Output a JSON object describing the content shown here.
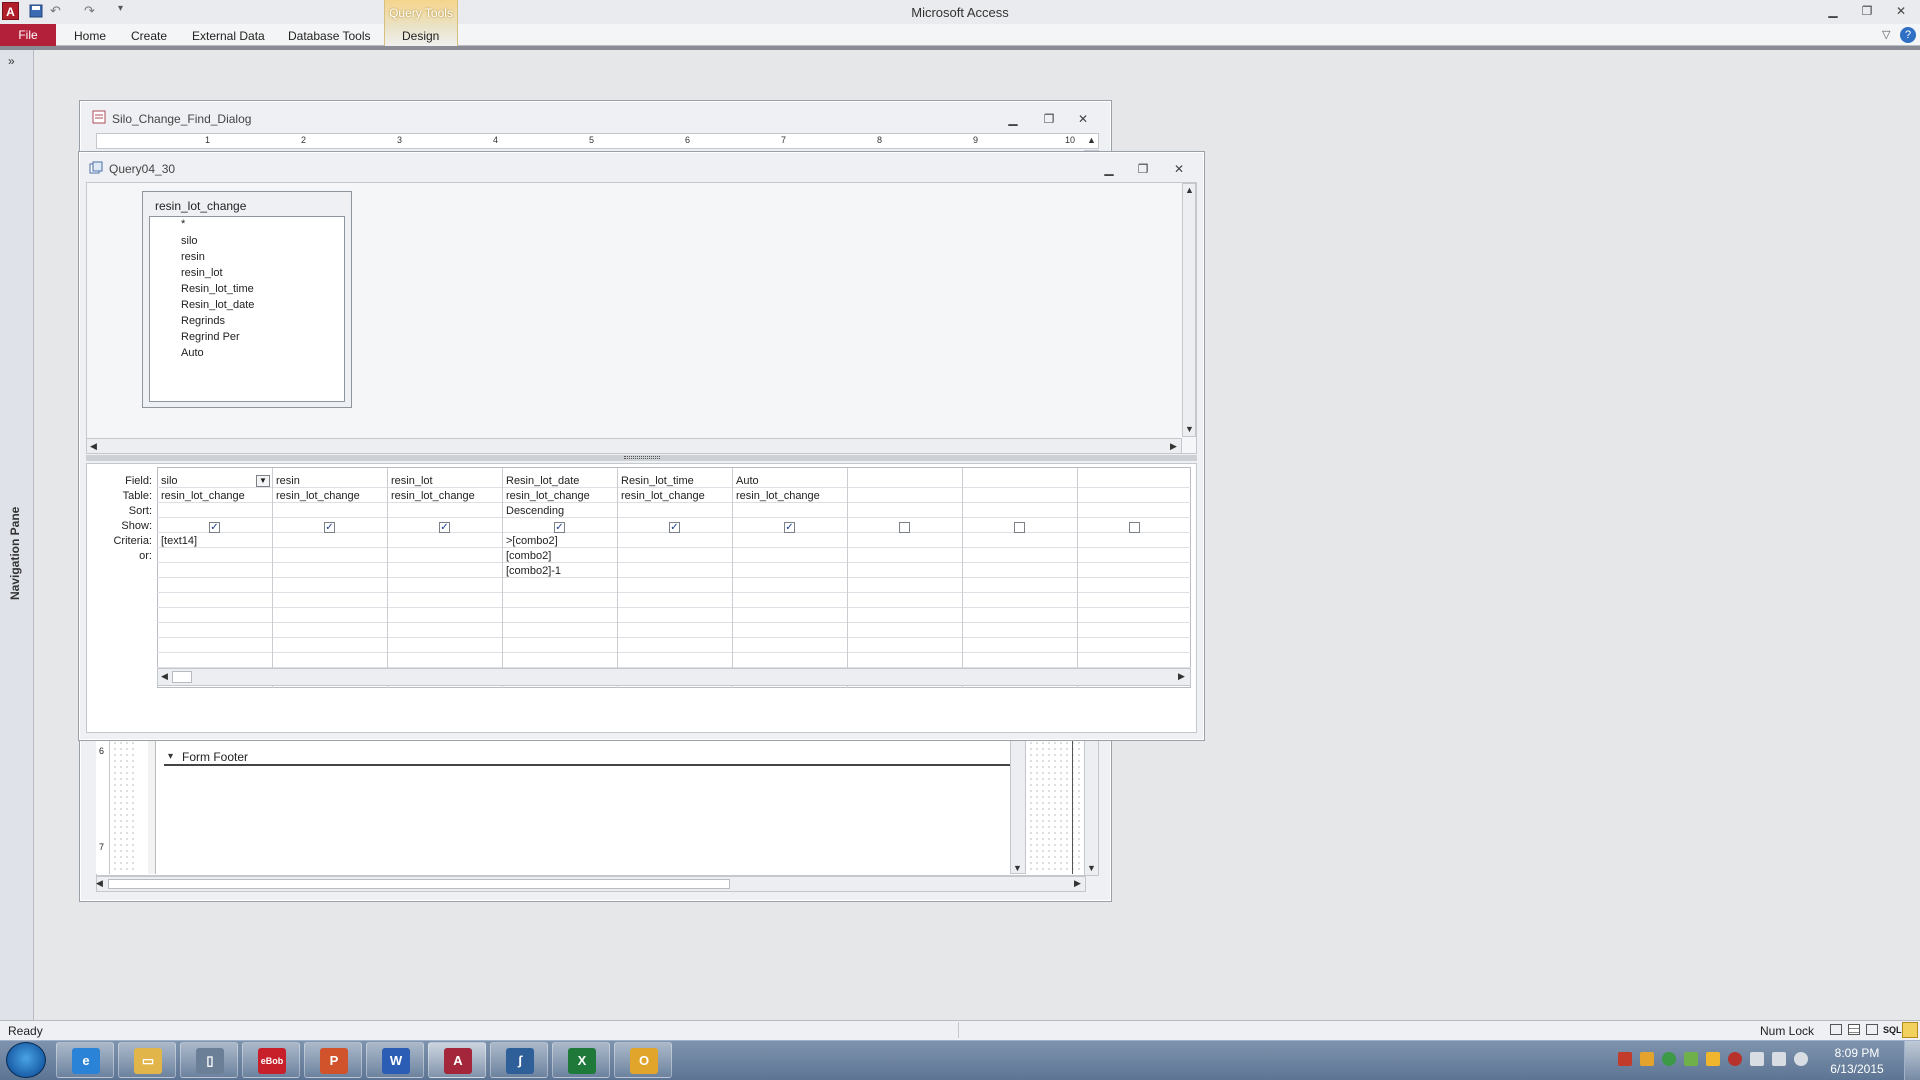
{
  "app": {
    "title": "Microsoft Access",
    "contextual_tab_group": "Query Tools"
  },
  "ribbon": {
    "tabs": [
      "File",
      "Home",
      "Create",
      "External Data",
      "Database Tools",
      "Design"
    ]
  },
  "nav_pane": {
    "label": "Navigation Pane",
    "toggle": "»"
  },
  "form_window": {
    "title": "Silo_Change_Find_Dialog",
    "ruler_numbers": [
      "1",
      "2",
      "3",
      "4",
      "5",
      "6",
      "7",
      "8",
      "9",
      "10"
    ],
    "footer_section": "Form Footer",
    "side_ruler_numbers": [
      "6",
      "7"
    ]
  },
  "query_window": {
    "title": "Query04_30",
    "table": {
      "name": "resin_lot_change",
      "fields": [
        "*",
        "silo",
        "resin",
        "resin_lot",
        "Resin_lot_time",
        "Resin_lot_date",
        "Regrinds",
        "Regrind Per",
        "Auto"
      ]
    },
    "grid": {
      "row_labels": [
        "Field:",
        "Table:",
        "Sort:",
        "Show:",
        "Criteria:",
        "or:"
      ],
      "columns": [
        {
          "field": "silo",
          "table": "resin_lot_change",
          "sort": "",
          "show": true,
          "criteria": "[text14]",
          "or": "",
          "or2": ""
        },
        {
          "field": "resin",
          "table": "resin_lot_change",
          "sort": "",
          "show": true,
          "criteria": "",
          "or": "",
          "or2": ""
        },
        {
          "field": "resin_lot",
          "table": "resin_lot_change",
          "sort": "",
          "show": true,
          "criteria": "",
          "or": "",
          "or2": ""
        },
        {
          "field": "Resin_lot_date",
          "table": "resin_lot_change",
          "sort": "Descending",
          "show": true,
          "criteria": ">[combo2]",
          "or": "[combo2]",
          "or2": "[combo2]-1"
        },
        {
          "field": "Resin_lot_time",
          "table": "resin_lot_change",
          "sort": "",
          "show": true,
          "criteria": "",
          "or": "",
          "or2": ""
        },
        {
          "field": "Auto",
          "table": "resin_lot_change",
          "sort": "",
          "show": true,
          "criteria": "",
          "or": "",
          "or2": ""
        },
        {
          "field": "",
          "table": "",
          "sort": "",
          "show": false,
          "criteria": "",
          "or": "",
          "or2": ""
        },
        {
          "field": "",
          "table": "",
          "sort": "",
          "show": false,
          "criteria": "",
          "or": "",
          "or2": ""
        },
        {
          "field": "",
          "table": "",
          "sort": "",
          "show": false,
          "criteria": "",
          "or": "",
          "or2": ""
        }
      ]
    }
  },
  "status_bar": {
    "status": "Ready",
    "indicator": "Num Lock",
    "sql_label": "SQL"
  },
  "taskbar": {
    "apps": [
      {
        "name": "internet-explorer",
        "glyph": "e",
        "color": "#2a83d6"
      },
      {
        "name": "file-explorer",
        "glyph": "▭",
        "color": "#e1b54a"
      },
      {
        "name": "documents",
        "glyph": "▯",
        "color": "#6b7f96"
      },
      {
        "name": "ebob",
        "glyph": "eBob",
        "color": "#c8202b"
      },
      {
        "name": "powerpoint",
        "glyph": "P",
        "color": "#d0532b"
      },
      {
        "name": "word",
        "glyph": "W",
        "color": "#2b5db5"
      },
      {
        "name": "access",
        "glyph": "A",
        "color": "#a4263a"
      },
      {
        "name": "python",
        "glyph": "ʃ",
        "color": "#2f5f99"
      },
      {
        "name": "excel",
        "glyph": "X",
        "color": "#1f7a3a"
      },
      {
        "name": "outlook",
        "glyph": "O",
        "color": "#e0a52a"
      }
    ],
    "clock_time": "8:09 PM",
    "clock_date": "6/13/2015"
  }
}
